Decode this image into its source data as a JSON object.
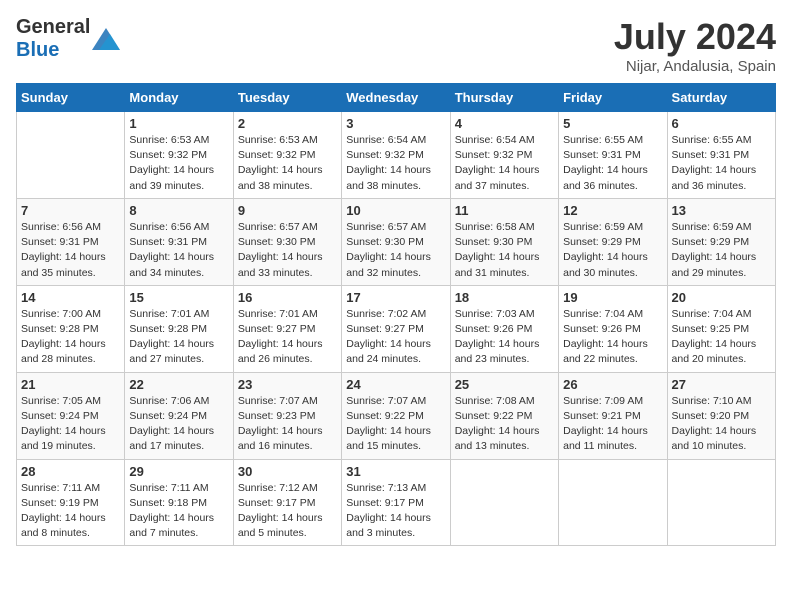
{
  "header": {
    "logo_general": "General",
    "logo_blue": "Blue",
    "title": "July 2024",
    "subtitle": "Nijar, Andalusia, Spain"
  },
  "days_of_week": [
    "Sunday",
    "Monday",
    "Tuesday",
    "Wednesday",
    "Thursday",
    "Friday",
    "Saturday"
  ],
  "weeks": [
    [
      {
        "day": "",
        "info": ""
      },
      {
        "day": "1",
        "info": "Sunrise: 6:53 AM\nSunset: 9:32 PM\nDaylight: 14 hours\nand 39 minutes."
      },
      {
        "day": "2",
        "info": "Sunrise: 6:53 AM\nSunset: 9:32 PM\nDaylight: 14 hours\nand 38 minutes."
      },
      {
        "day": "3",
        "info": "Sunrise: 6:54 AM\nSunset: 9:32 PM\nDaylight: 14 hours\nand 38 minutes."
      },
      {
        "day": "4",
        "info": "Sunrise: 6:54 AM\nSunset: 9:32 PM\nDaylight: 14 hours\nand 37 minutes."
      },
      {
        "day": "5",
        "info": "Sunrise: 6:55 AM\nSunset: 9:31 PM\nDaylight: 14 hours\nand 36 minutes."
      },
      {
        "day": "6",
        "info": "Sunrise: 6:55 AM\nSunset: 9:31 PM\nDaylight: 14 hours\nand 36 minutes."
      }
    ],
    [
      {
        "day": "7",
        "info": "Sunrise: 6:56 AM\nSunset: 9:31 PM\nDaylight: 14 hours\nand 35 minutes."
      },
      {
        "day": "8",
        "info": "Sunrise: 6:56 AM\nSunset: 9:31 PM\nDaylight: 14 hours\nand 34 minutes."
      },
      {
        "day": "9",
        "info": "Sunrise: 6:57 AM\nSunset: 9:30 PM\nDaylight: 14 hours\nand 33 minutes."
      },
      {
        "day": "10",
        "info": "Sunrise: 6:57 AM\nSunset: 9:30 PM\nDaylight: 14 hours\nand 32 minutes."
      },
      {
        "day": "11",
        "info": "Sunrise: 6:58 AM\nSunset: 9:30 PM\nDaylight: 14 hours\nand 31 minutes."
      },
      {
        "day": "12",
        "info": "Sunrise: 6:59 AM\nSunset: 9:29 PM\nDaylight: 14 hours\nand 30 minutes."
      },
      {
        "day": "13",
        "info": "Sunrise: 6:59 AM\nSunset: 9:29 PM\nDaylight: 14 hours\nand 29 minutes."
      }
    ],
    [
      {
        "day": "14",
        "info": "Sunrise: 7:00 AM\nSunset: 9:28 PM\nDaylight: 14 hours\nand 28 minutes."
      },
      {
        "day": "15",
        "info": "Sunrise: 7:01 AM\nSunset: 9:28 PM\nDaylight: 14 hours\nand 27 minutes."
      },
      {
        "day": "16",
        "info": "Sunrise: 7:01 AM\nSunset: 9:27 PM\nDaylight: 14 hours\nand 26 minutes."
      },
      {
        "day": "17",
        "info": "Sunrise: 7:02 AM\nSunset: 9:27 PM\nDaylight: 14 hours\nand 24 minutes."
      },
      {
        "day": "18",
        "info": "Sunrise: 7:03 AM\nSunset: 9:26 PM\nDaylight: 14 hours\nand 23 minutes."
      },
      {
        "day": "19",
        "info": "Sunrise: 7:04 AM\nSunset: 9:26 PM\nDaylight: 14 hours\nand 22 minutes."
      },
      {
        "day": "20",
        "info": "Sunrise: 7:04 AM\nSunset: 9:25 PM\nDaylight: 14 hours\nand 20 minutes."
      }
    ],
    [
      {
        "day": "21",
        "info": "Sunrise: 7:05 AM\nSunset: 9:24 PM\nDaylight: 14 hours\nand 19 minutes."
      },
      {
        "day": "22",
        "info": "Sunrise: 7:06 AM\nSunset: 9:24 PM\nDaylight: 14 hours\nand 17 minutes."
      },
      {
        "day": "23",
        "info": "Sunrise: 7:07 AM\nSunset: 9:23 PM\nDaylight: 14 hours\nand 16 minutes."
      },
      {
        "day": "24",
        "info": "Sunrise: 7:07 AM\nSunset: 9:22 PM\nDaylight: 14 hours\nand 15 minutes."
      },
      {
        "day": "25",
        "info": "Sunrise: 7:08 AM\nSunset: 9:22 PM\nDaylight: 14 hours\nand 13 minutes."
      },
      {
        "day": "26",
        "info": "Sunrise: 7:09 AM\nSunset: 9:21 PM\nDaylight: 14 hours\nand 11 minutes."
      },
      {
        "day": "27",
        "info": "Sunrise: 7:10 AM\nSunset: 9:20 PM\nDaylight: 14 hours\nand 10 minutes."
      }
    ],
    [
      {
        "day": "28",
        "info": "Sunrise: 7:11 AM\nSunset: 9:19 PM\nDaylight: 14 hours\nand 8 minutes."
      },
      {
        "day": "29",
        "info": "Sunrise: 7:11 AM\nSunset: 9:18 PM\nDaylight: 14 hours\nand 7 minutes."
      },
      {
        "day": "30",
        "info": "Sunrise: 7:12 AM\nSunset: 9:17 PM\nDaylight: 14 hours\nand 5 minutes."
      },
      {
        "day": "31",
        "info": "Sunrise: 7:13 AM\nSunset: 9:17 PM\nDaylight: 14 hours\nand 3 minutes."
      },
      {
        "day": "",
        "info": ""
      },
      {
        "day": "",
        "info": ""
      },
      {
        "day": "",
        "info": ""
      }
    ]
  ]
}
